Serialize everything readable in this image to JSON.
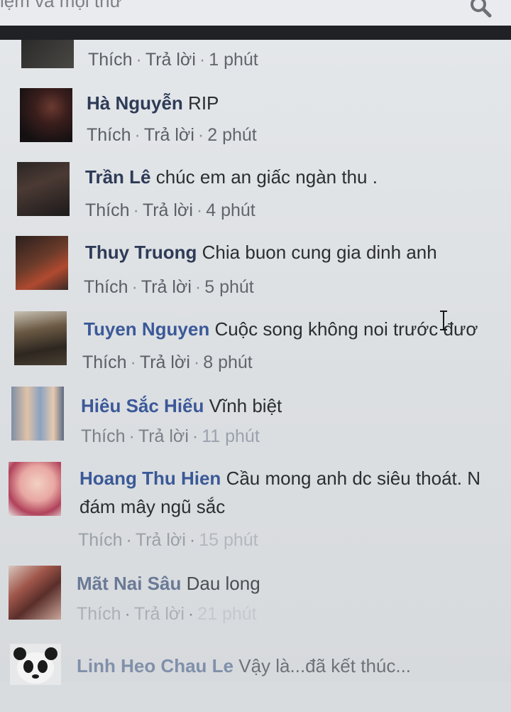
{
  "search": {
    "text": "iệm và mọi thứ"
  },
  "labels": {
    "like": "Thích",
    "reply": "Trả lời",
    "dot": "·"
  },
  "comments": [
    {
      "name": "",
      "text": "",
      "time": "1 phút"
    },
    {
      "name": "Hà Nguyễn",
      "text": "RIP",
      "time": "2 phút"
    },
    {
      "name": "Trần Lê",
      "text": "chúc em an giấc ngàn thu .",
      "time": "4 phút"
    },
    {
      "name": "Thuy Truong",
      "text": "Chia buon cung gia dinh anh",
      "time": "5 phút"
    },
    {
      "name": "Tuyen Nguyen",
      "text": "Cuộc song không noi trước đươ",
      "time": "8 phút"
    },
    {
      "name": "Hiêu Sắc Hiếu",
      "text": "Vĩnh biệt",
      "time": "11 phút"
    },
    {
      "name": "Hoang Thu Hien",
      "text": "Cầu mong anh dc siêu thoát. N",
      "text2": "đám mây ngũ sắc",
      "time": "15 phút"
    },
    {
      "name": "Mãt Nai Sâu",
      "text": "Dau long",
      "time": "21 phút"
    },
    {
      "name": "Linh Heo Chau Le",
      "text": "Vậy là...đã kết thúc..."
    }
  ],
  "icons": {
    "search": "search-icon",
    "cursor": "text-cursor-icon"
  }
}
